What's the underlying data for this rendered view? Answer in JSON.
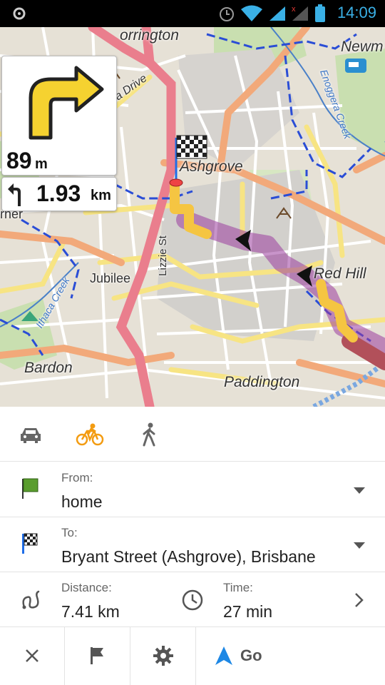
{
  "status_bar": {
    "time": "14:09",
    "icons": [
      "app-icon",
      "alarm-icon",
      "wifi-icon",
      "signal-icon",
      "no-signal-icon",
      "battery-icon"
    ]
  },
  "map": {
    "labels": [
      "orrington",
      "Newm",
      "acia Drive",
      "Ashgrove",
      "rner",
      "Jubilee",
      "Lizzie St",
      "Red Hill",
      "Ithaca Creek",
      "Enoggera Creek",
      "Bardon",
      "Paddington"
    ],
    "route_color": "#9b3d9e",
    "highlight_color": "#f5c542"
  },
  "turn": {
    "distance_value": "89",
    "distance_unit": "m",
    "next_distance_value": "1.93",
    "next_distance_unit": "km"
  },
  "modes": [
    {
      "icon": "car-icon",
      "active": false
    },
    {
      "icon": "bicycle-icon",
      "active": true
    },
    {
      "icon": "walk-icon",
      "active": false
    }
  ],
  "from": {
    "label": "From:",
    "value": "home"
  },
  "to": {
    "label": "To:",
    "value": "Bryant Street (Ashgrove), Brisbane"
  },
  "stats": {
    "distance_label": "Distance:",
    "distance_value": "7.41 km",
    "time_label": "Time:",
    "time_value": "27 min"
  },
  "actions": {
    "go_label": "Go"
  },
  "colors": {
    "accent": "#1e88e5",
    "active_mode": "#f39c12",
    "flag_green": "#5a9d2e"
  }
}
